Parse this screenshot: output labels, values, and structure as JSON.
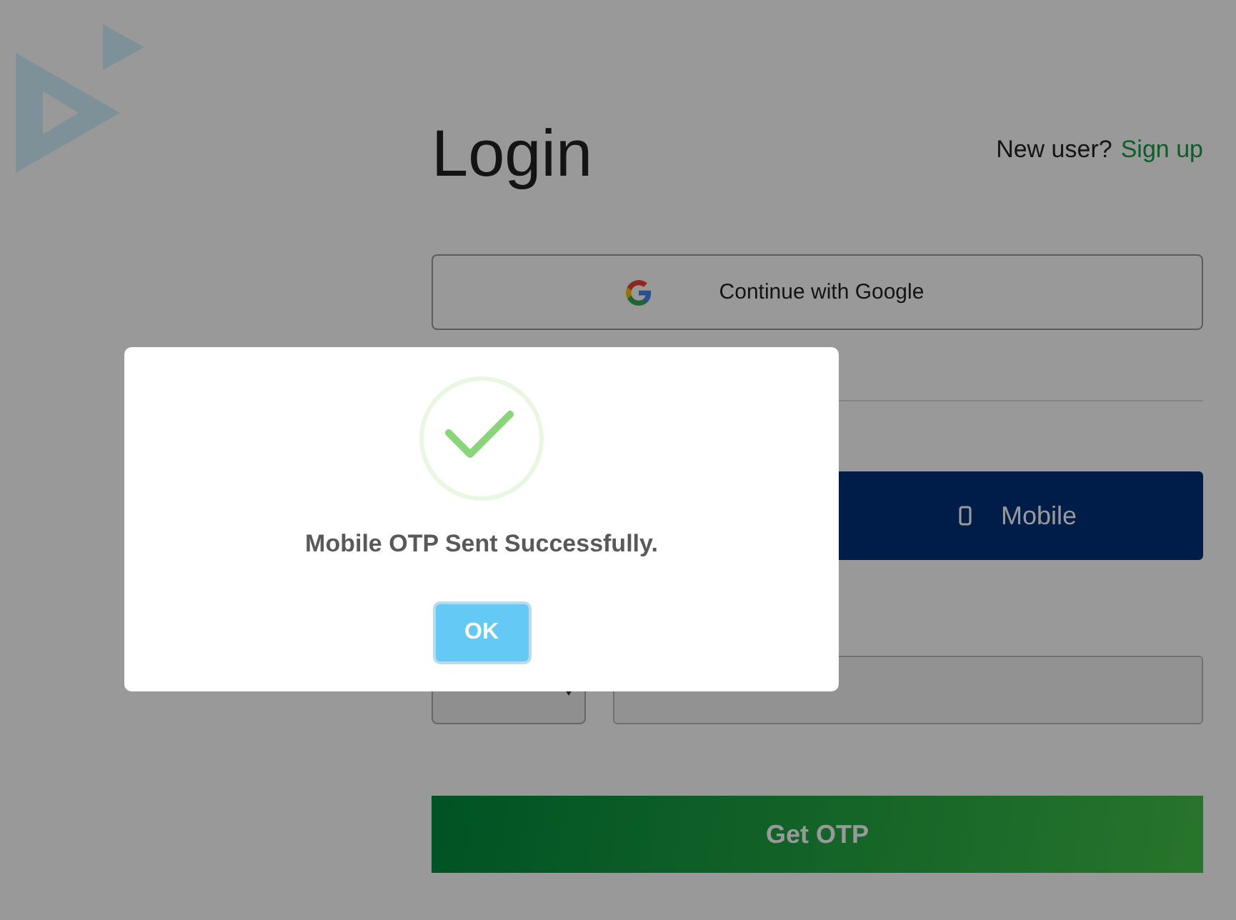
{
  "title": "Login",
  "signup": {
    "prompt": "New user?",
    "link": "Sign up"
  },
  "google_button": "Continue with Google",
  "tabs": [
    {
      "label": "Mobile",
      "selected": true
    }
  ],
  "submit": "Get OTP",
  "dialog": {
    "success": true,
    "message": "Mobile OTP Sent Successfully.",
    "button": "OK"
  }
}
